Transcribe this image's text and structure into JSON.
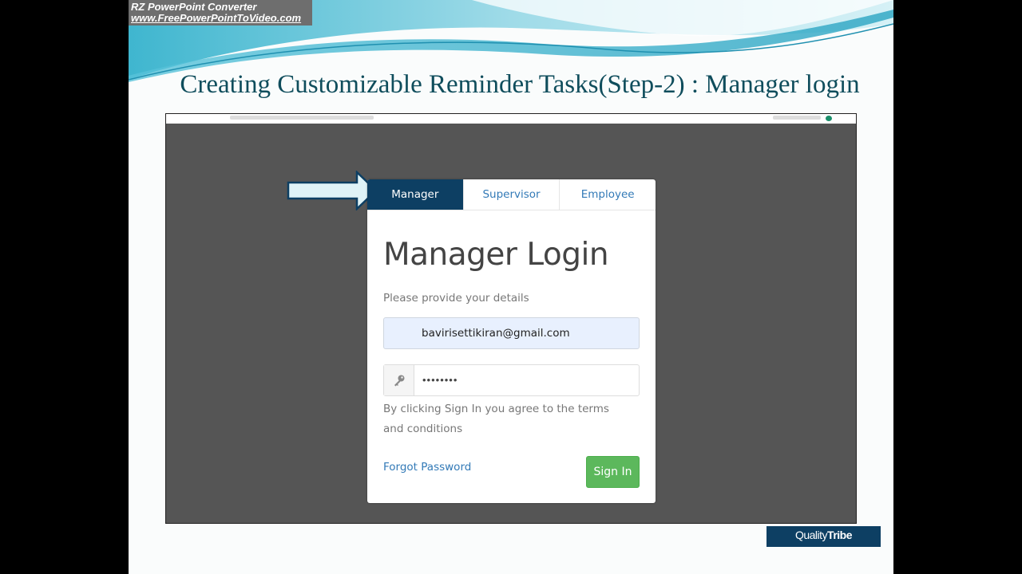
{
  "watermark": {
    "line1": "RZ PowerPoint Converter",
    "line2": "www.FreePowerPointToVideo.com"
  },
  "slide": {
    "title": "Creating Customizable Reminder Tasks(Step-2) : Manager login"
  },
  "login": {
    "tabs": [
      {
        "label": "Manager",
        "active": true
      },
      {
        "label": "Supervisor",
        "active": false
      },
      {
        "label": "Employee",
        "active": false
      }
    ],
    "title": "Manager Login",
    "subtitle": "Please provide your details",
    "email_value": "bavirisettikiran@gmail.com",
    "password_value": "••••••••",
    "terms": "By clicking Sign In you agree to the terms and conditions",
    "forgot_label": "Forgot Password",
    "signin_label": "Sign In"
  },
  "logo": {
    "name_part1": "Quality",
    "name_part2": "Tribe"
  },
  "icons": {
    "password": "key-icon",
    "pointer": "arrow-right-icon"
  },
  "colors": {
    "active_tab": "#0d3f63",
    "link": "#337ab7",
    "signin": "#5cb85c",
    "title": "#0f4d5c"
  }
}
